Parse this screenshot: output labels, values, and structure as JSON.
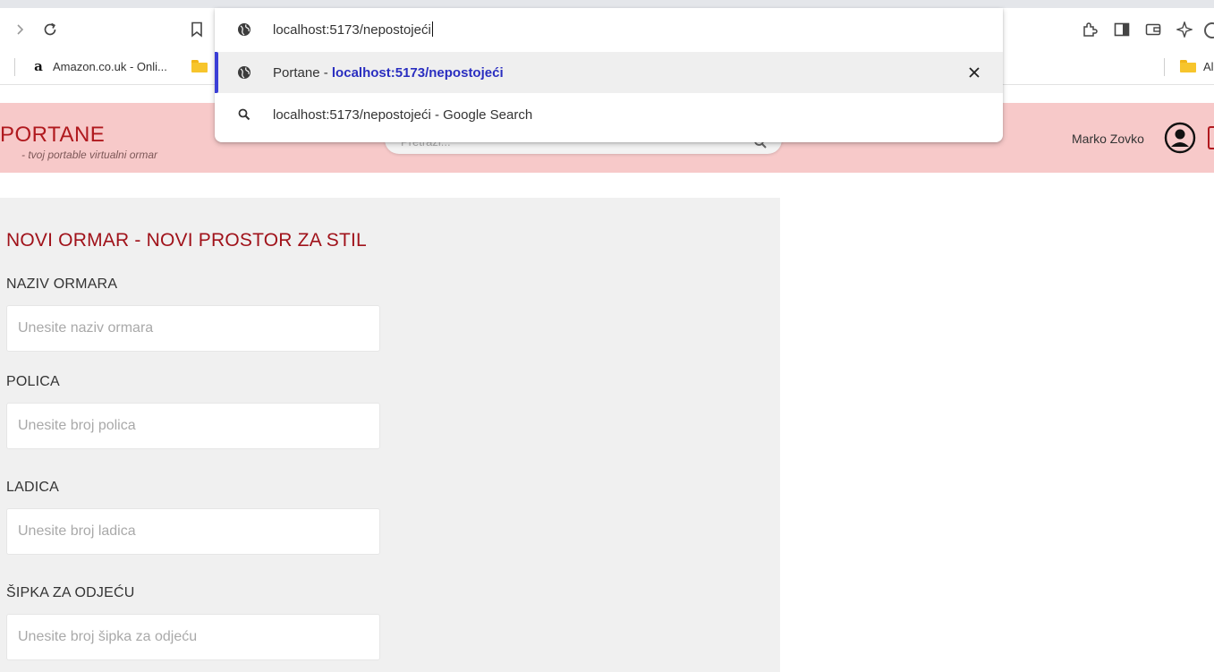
{
  "browser": {
    "omnibox": {
      "input_text": "localhost:5173/nepostojeći",
      "suggestions": [
        {
          "title": "Portane",
          "separator": " - ",
          "url": "localhost:5173/nepostojeći"
        },
        {
          "query": "localhost:5173/nepostojeći",
          "suffix": " - Google Search"
        }
      ]
    },
    "bookmarks": [
      {
        "label": "Amazon.co.uk - Onli...",
        "icon": "amazon-icon"
      },
      {
        "label": "",
        "icon": "folder-icon"
      },
      {
        "label": "Al",
        "icon": "folder-icon"
      }
    ]
  },
  "app": {
    "brand": "PORTANE",
    "tagline": "- tvoj portable virtualni ormar",
    "search_placeholder": "Pretraži...",
    "user_name": "Marko Zovko",
    "accent_color": "#b0191e",
    "header_color": "#f7c9c9"
  },
  "form": {
    "title": "NOVI ORMAR - NOVI PROSTOR ZA STIL",
    "fields": [
      {
        "label": "NAZIV ORMARA",
        "placeholder": "Unesite naziv ormara"
      },
      {
        "label": "POLICA",
        "placeholder": "Unesite broj polica"
      },
      {
        "label": "LADICA",
        "placeholder": "Unesite broj ladica"
      },
      {
        "label": "ŠIPKA ZA ODJEĆU",
        "placeholder": "Unesite broj šipka za odjeću"
      }
    ]
  }
}
